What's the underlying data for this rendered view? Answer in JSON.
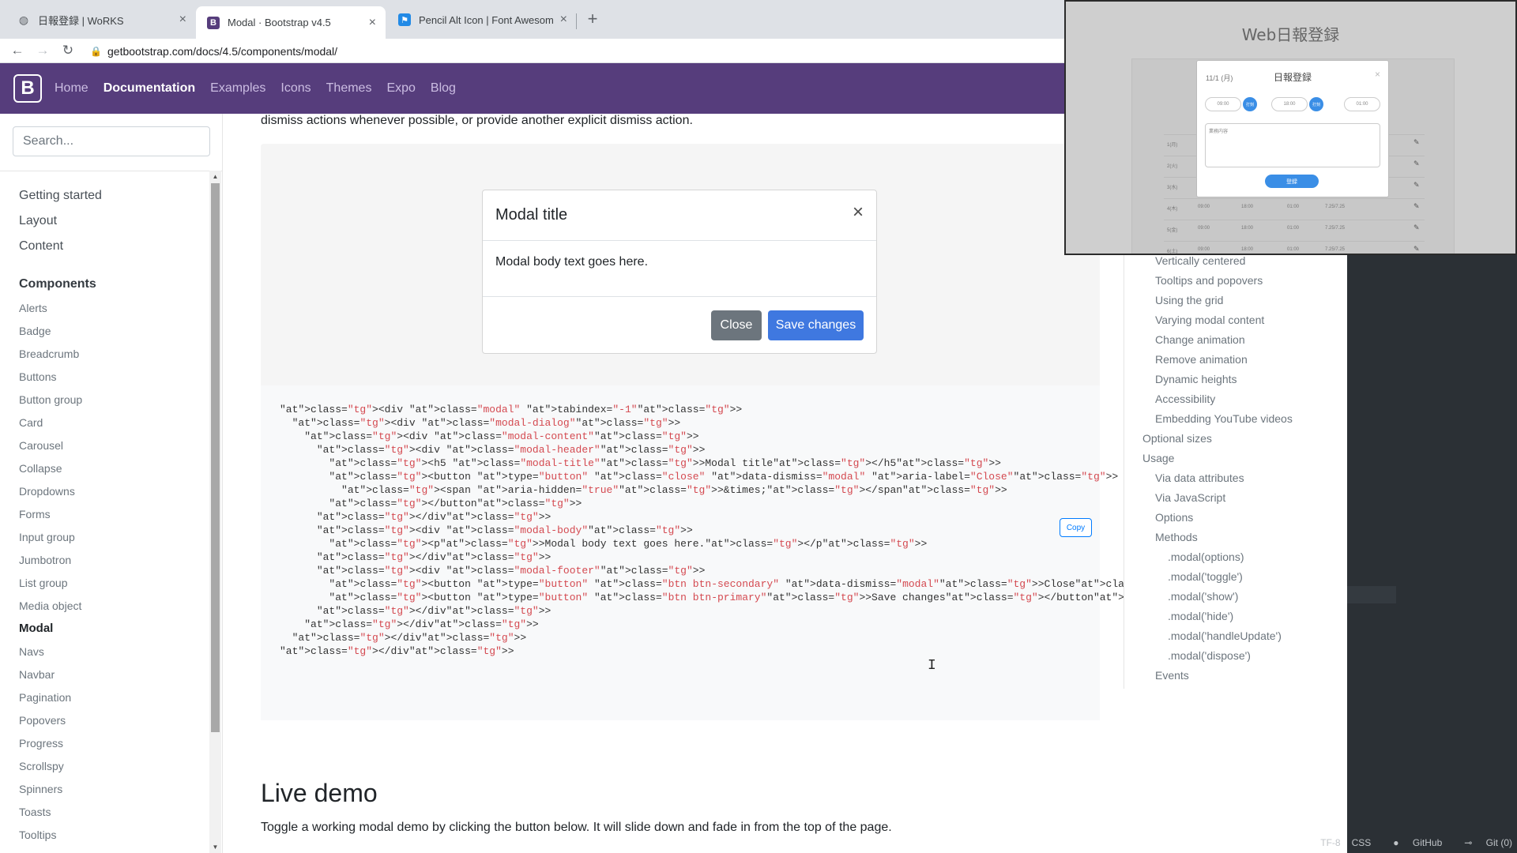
{
  "browser": {
    "tabs": [
      {
        "title": "日報登録 | WoRKS",
        "active": false
      },
      {
        "title": "Modal · Bootstrap v4.5",
        "active": true
      },
      {
        "title": "Pencil Alt Icon | Font Awesome",
        "active": false
      }
    ],
    "tab_close": "×",
    "newtab": "+",
    "url": "getbootstrap.com/docs/4.5/components/modal/"
  },
  "navbar": {
    "brand": "B",
    "links": [
      "Home",
      "Documentation",
      "Examples",
      "Icons",
      "Themes",
      "Expo",
      "Blog"
    ]
  },
  "sidebar": {
    "search_placeholder": "Search...",
    "groups": [
      "Getting started",
      "Layout",
      "Content",
      "Components"
    ],
    "items": [
      "Alerts",
      "Badge",
      "Breadcrumb",
      "Buttons",
      "Button group",
      "Card",
      "Carousel",
      "Collapse",
      "Dropdowns",
      "Forms",
      "Input group",
      "Jumbotron",
      "List group",
      "Media object",
      "Modal",
      "Navs",
      "Navbar",
      "Pagination",
      "Popovers",
      "Progress",
      "Scrollspy",
      "Spinners",
      "Toasts",
      "Tooltips"
    ],
    "active_item": "Modal"
  },
  "main": {
    "intro": "dismiss actions whenever possible, or provide another explicit dismiss action.",
    "modal": {
      "title": "Modal title",
      "close": "×",
      "body": "Modal body text goes here.",
      "btn_close": "Close",
      "btn_save": "Save changes"
    },
    "copy_label": "Copy",
    "code_lines": [
      "<div class=\"modal\" tabindex=\"-1\">",
      "  <div class=\"modal-dialog\">",
      "    <div class=\"modal-content\">",
      "      <div class=\"modal-header\">",
      "        <h5 class=\"modal-title\">Modal title</h5>",
      "        <button type=\"button\" class=\"close\" data-dismiss=\"modal\" aria-label=\"Close\">",
      "          <span aria-hidden=\"true\">&times;</span>",
      "        </button>",
      "      </div>",
      "      <div class=\"modal-body\">",
      "        <p>Modal body text goes here.</p>",
      "      </div>",
      "      <div class=\"modal-footer\">",
      "        <button type=\"button\" class=\"btn btn-secondary\" data-dismiss=\"modal\">Close</button>",
      "        <button type=\"button\" class=\"btn btn-primary\">Save changes</button>",
      "      </div>",
      "    </div>",
      "  </div>",
      "</div>"
    ],
    "live_demo_heading": "Live demo",
    "live_demo_text": "Toggle a working modal demo by clicking the button below. It will slide down and fade in from the top of the page."
  },
  "toc": {
    "items": [
      {
        "label": "Vertically centered",
        "level": 2
      },
      {
        "label": "Tooltips and popovers",
        "level": 2
      },
      {
        "label": "Using the grid",
        "level": 2
      },
      {
        "label": "Varying modal content",
        "level": 2
      },
      {
        "label": "Change animation",
        "level": 2
      },
      {
        "label": "Remove animation",
        "level": 2
      },
      {
        "label": "Dynamic heights",
        "level": 2
      },
      {
        "label": "Accessibility",
        "level": 2
      },
      {
        "label": "Embedding YouTube videos",
        "level": 2
      },
      {
        "label": "Optional sizes",
        "level": 1
      },
      {
        "label": "Usage",
        "level": 1
      },
      {
        "label": "Via data attributes",
        "level": 2
      },
      {
        "label": "Via JavaScript",
        "level": 2
      },
      {
        "label": "Options",
        "level": 2
      },
      {
        "label": "Methods",
        "level": 2
      },
      {
        "label": ".modal(options)",
        "level": 3
      },
      {
        "label": ".modal('toggle')",
        "level": 3
      },
      {
        "label": ".modal('show')",
        "level": 3
      },
      {
        "label": ".modal('hide')",
        "level": 3
      },
      {
        "label": ".modal('handleUpdate')",
        "level": 3
      },
      {
        "label": ".modal('dispose')",
        "level": 3
      },
      {
        "label": "Events",
        "level": 2
      }
    ]
  },
  "statusbar": {
    "items": [
      "TF-8",
      "CSS",
      "GitHub",
      "Git (0)"
    ]
  },
  "overlay": {
    "title": "Web日報登録",
    "modal_date": "11/1 (月)",
    "modal_title": "日報登録",
    "modal_close": "×",
    "field_start": "09:00",
    "field_end": "18:00",
    "field_break": "01:00",
    "dot_label": "打刻",
    "textarea_placeholder": "業務内容",
    "submit": "登録",
    "table_rows": [
      {
        "day": "1(月)",
        "a": "",
        "b": "",
        "c": "",
        "d": ""
      },
      {
        "day": "2(火)",
        "a": "",
        "b": "",
        "c": "",
        "d": ""
      },
      {
        "day": "3(水)",
        "a": "",
        "b": "",
        "c": "",
        "d": ""
      },
      {
        "day": "4(木)",
        "a": "09:00",
        "b": "18:00",
        "c": "01:00",
        "d": "7.25/7.25"
      },
      {
        "day": "5(金)",
        "a": "09:00",
        "b": "18:00",
        "c": "01:00",
        "d": "7.25/7.25"
      },
      {
        "day": "6(土)",
        "a": "09:00",
        "b": "18:00",
        "c": "01:00",
        "d": "7.25/7.25"
      }
    ]
  }
}
